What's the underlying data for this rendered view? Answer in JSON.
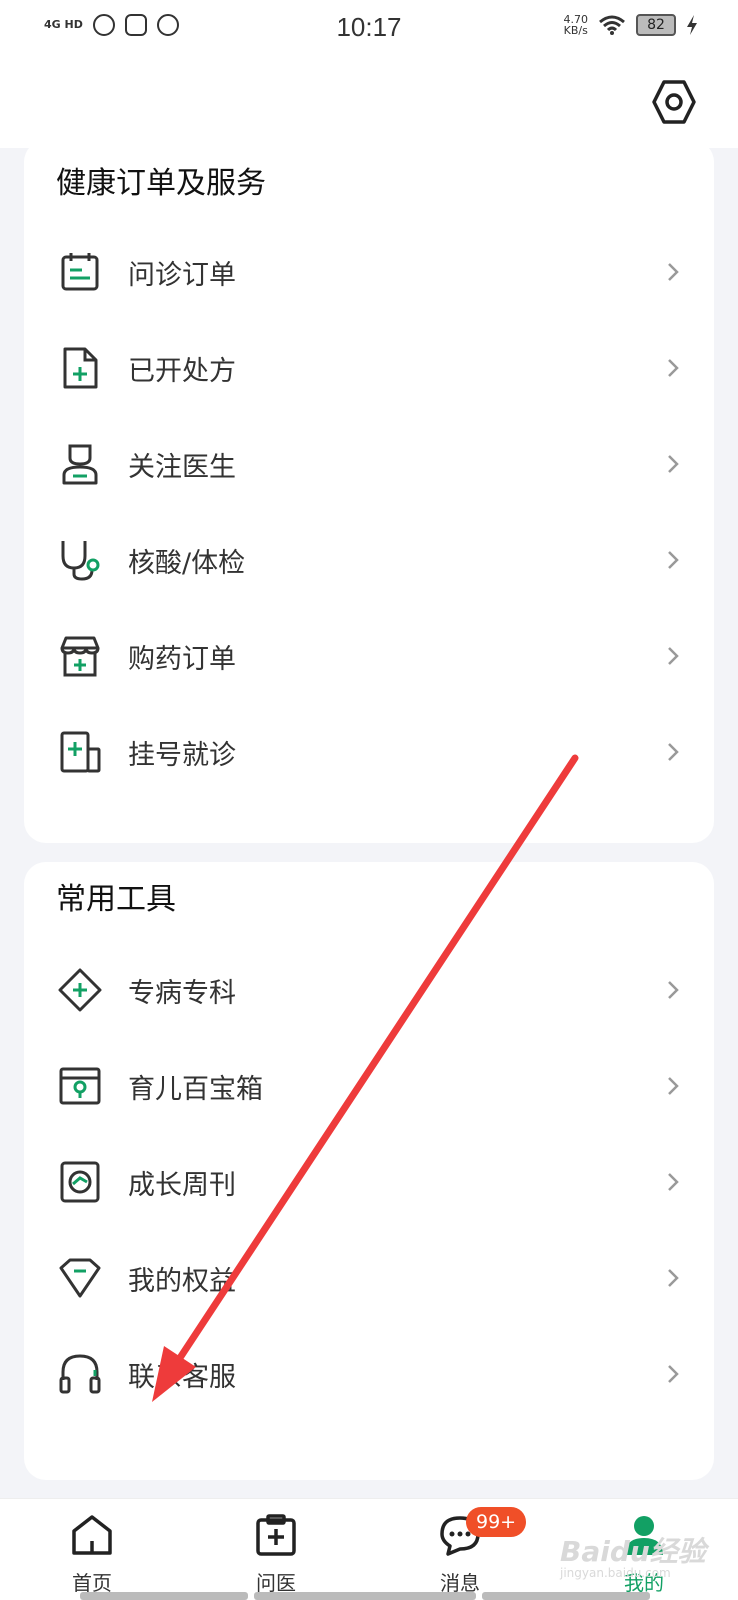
{
  "status_bar": {
    "network": "4G HD",
    "time": "10:17",
    "speed_value": "4.70",
    "speed_unit": "KB/s",
    "battery": "82"
  },
  "sections": {
    "health": {
      "title": "健康订单及服务",
      "items": [
        {
          "label": "问诊订单",
          "icon": "order-list-icon"
        },
        {
          "label": "已开处方",
          "icon": "prescription-icon"
        },
        {
          "label": "关注医生",
          "icon": "doctor-icon"
        },
        {
          "label": "核酸/体检",
          "icon": "stethoscope-icon"
        },
        {
          "label": "购药订单",
          "icon": "pharmacy-icon"
        },
        {
          "label": "挂号就诊",
          "icon": "registration-icon"
        }
      ]
    },
    "tools": {
      "title": "常用工具",
      "items": [
        {
          "label": "专病专科",
          "icon": "diamond-plus-icon"
        },
        {
          "label": "育儿百宝箱",
          "icon": "parenting-box-icon"
        },
        {
          "label": "成长周刊",
          "icon": "growth-weekly-icon"
        },
        {
          "label": "我的权益",
          "icon": "gem-icon"
        },
        {
          "label": "联系客服",
          "icon": "headset-icon"
        }
      ]
    }
  },
  "bottom_nav": {
    "items": [
      {
        "label": "首页",
        "icon": "home-icon"
      },
      {
        "label": "问医",
        "icon": "medical-kit-icon"
      },
      {
        "label": "消息",
        "icon": "chat-bubble-icon",
        "badge": "99+"
      },
      {
        "label": "我的",
        "icon": "profile-icon",
        "active": true
      }
    ]
  },
  "watermark": {
    "text": "Baidu经验",
    "sub": "jingyan.baidu.com"
  },
  "colors": {
    "accent": "#12a064",
    "badge": "#f04f28",
    "annotation_arrow": "#ee3b3b"
  }
}
